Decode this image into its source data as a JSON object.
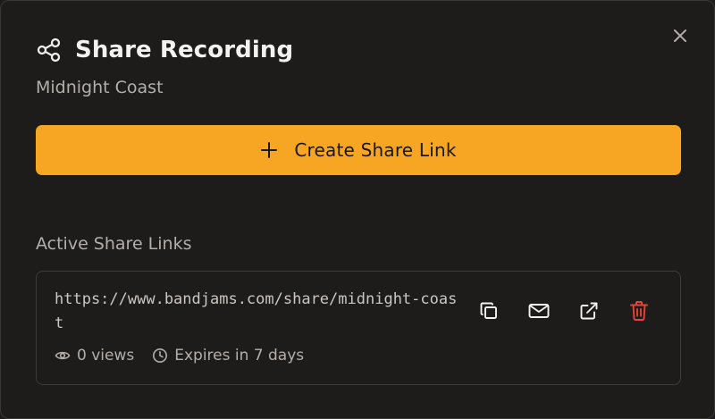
{
  "dialog": {
    "title": "Share Recording",
    "subtitle": "Midnight Coast",
    "create_button_label": "Create Share Link",
    "section_label": "Active Share Links"
  },
  "share_links": [
    {
      "url": "https://www.bandjams.com/share/midnight-coast",
      "views": "0 views",
      "expires": "Expires in 7 days"
    }
  ],
  "icons": {
    "title": "share-icon",
    "close": "close-icon",
    "create": "plus-icon",
    "views": "eye-icon",
    "expires": "clock-icon",
    "copy": "copy-icon",
    "email": "mail-icon",
    "open": "external-link-icon",
    "delete": "trash-icon"
  },
  "colors": {
    "background": "#1e1c1b",
    "accent": "#f6a623",
    "danger": "#e5443a",
    "text_primary": "#f4f2f0",
    "text_secondary": "#b3aeaa"
  }
}
